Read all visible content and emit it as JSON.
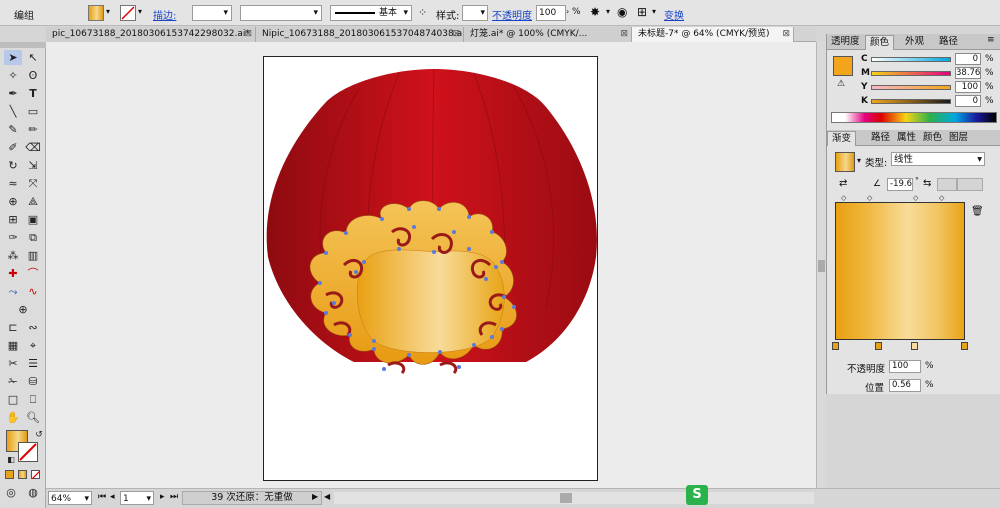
{
  "control_bar": {
    "group_label": "编组",
    "stroke_label": "描边:",
    "stroke_style_label": "基本",
    "style_label": "样式:",
    "opacity_label": "不透明度",
    "opacity_value": "100",
    "opacity_unit": "%",
    "transform_link": "变换"
  },
  "doc_tabs": [
    {
      "label": "pic_10673188_20180306153742298032.ai*"
    },
    {
      "label": "Nipic_10673188_20180306153704874038.ai"
    },
    {
      "label": "灯笼.ai* @ 100% (CMYK/..."
    },
    {
      "label": "未标题-7* @ 64% (CMYK/预览)"
    }
  ],
  "status_bar": {
    "zoom": "64%",
    "page": "1",
    "history": "39 次还原：无重做"
  },
  "color_panel": {
    "tabs": [
      "透明度",
      "颜色",
      "外观",
      "路径"
    ],
    "channels": [
      {
        "name": "C",
        "value": "0"
      },
      {
        "name": "M",
        "value": "38.76"
      },
      {
        "name": "Y",
        "value": "100"
      },
      {
        "name": "K",
        "value": "0"
      }
    ],
    "unit": "%",
    "fill_color": "#f2a51c"
  },
  "gradient_panel": {
    "tabs": [
      "渐变",
      "路径",
      "属性",
      "颜色",
      "图层"
    ],
    "type_label": "类型:",
    "type_value": "线性",
    "angle_value": "-19.6",
    "angle_unit": "°",
    "opacity_label": "不透明度",
    "opacity_value": "100",
    "location_label": "位置",
    "location_value": "0.56",
    "unit": "%"
  },
  "colors": {
    "lantern_red": "#c30d16",
    "gold_dark": "#e9a012",
    "gold_light": "#f8dc9a",
    "swirl_brown": "#9a1a1a",
    "anchor_blue": "#5a7ae0",
    "link_blue": "#1a44c8"
  }
}
